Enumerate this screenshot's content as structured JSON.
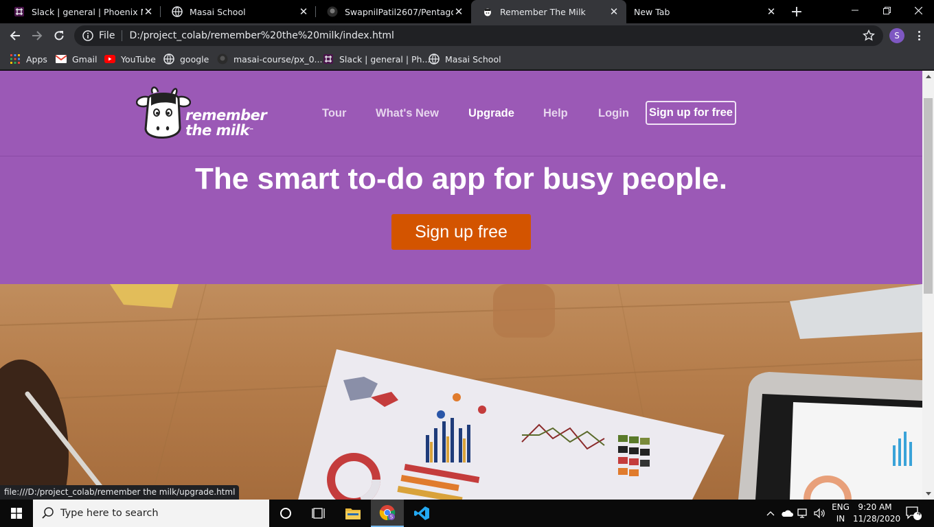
{
  "browser": {
    "tabs": [
      {
        "title": "Slack | general | Phoenix Masai",
        "favicon": "slack-icon",
        "active": false
      },
      {
        "title": "Masai School",
        "favicon": "globe-icon",
        "active": false
      },
      {
        "title": "SwapnilPatil2607/Pentagon",
        "favicon": "github-icon",
        "active": false
      },
      {
        "title": "Remember The Milk",
        "favicon": "cow-icon",
        "active": true
      },
      {
        "title": "New Tab",
        "favicon": "",
        "active": false
      }
    ],
    "address": {
      "scheme": "File",
      "url": "D:/project_colab/remember%20the%20milk/index.html"
    },
    "profile_initial": "S",
    "bookmarks": [
      {
        "label": "Apps",
        "icon": "apps-grid-icon"
      },
      {
        "label": "Gmail",
        "icon": "gmail-icon"
      },
      {
        "label": "YouTube",
        "icon": "youtube-icon"
      },
      {
        "label": "google",
        "icon": "globe-icon"
      },
      {
        "label": "masai-course/px_0...",
        "icon": "github-icon"
      },
      {
        "label": "Slack | general | Ph...",
        "icon": "slack-icon"
      },
      {
        "label": "Masai School",
        "icon": "globe-icon"
      }
    ],
    "status_url": "file:///D:/project_colab/remember the milk/upgrade.html"
  },
  "site": {
    "logo_line1": "remember",
    "logo_line2": "the milk",
    "logo_tm": "™",
    "nav": [
      {
        "label": "Tour",
        "strong": false
      },
      {
        "label": "What's New",
        "strong": false
      },
      {
        "label": "Upgrade",
        "strong": true
      },
      {
        "label": "Help",
        "strong": false
      },
      {
        "label": "Login",
        "strong": false
      }
    ],
    "signup_nav": "Sign up for free",
    "headline": "The smart to-do app for busy people.",
    "cta": "Sign up free",
    "colors": {
      "hero": "#9b59b6",
      "cta": "#d35400"
    }
  },
  "taskbar": {
    "search_placeholder": "Type here to search",
    "lang_line1": "ENG",
    "lang_line2": "IN",
    "time": "9:20 AM",
    "date": "11/28/2020",
    "notifications": "4"
  }
}
